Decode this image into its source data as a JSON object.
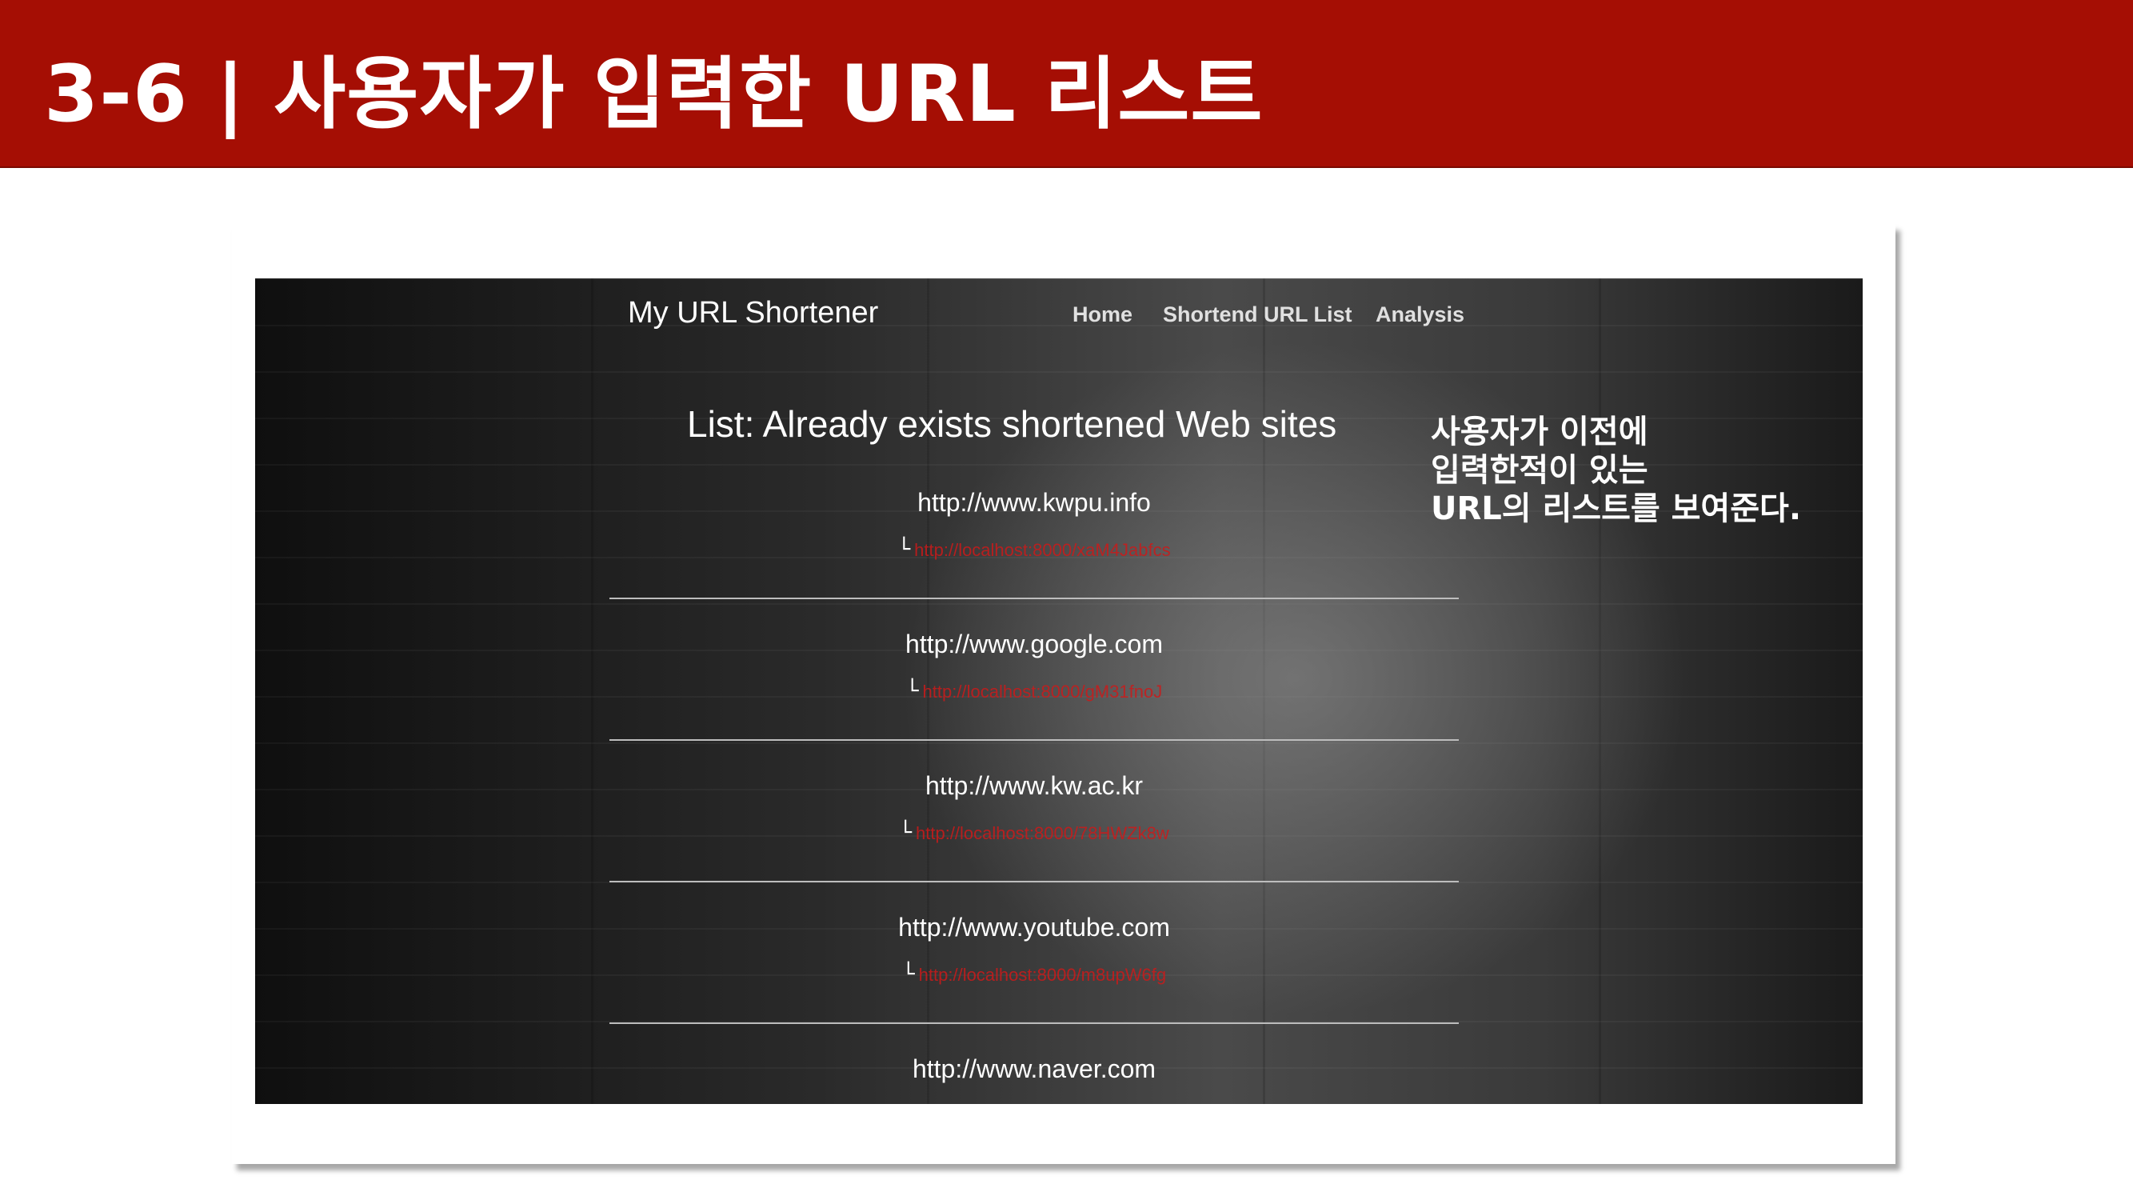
{
  "slide": {
    "title": "3-6 | 사용자가 입력한 URL 리스트"
  },
  "app": {
    "brand": "My URL Shortener",
    "nav": {
      "home": "Home",
      "list": "Shortend URL List",
      "analysis": "Analysis"
    },
    "heading": "List: Already exists shortened Web sites"
  },
  "annotation": {
    "lines": [
      "사용자가 이전에",
      "입력한적이 있는",
      "URL의 리스트를 보여준다."
    ]
  },
  "corner_glyph": "└",
  "entries": [
    {
      "original": "http://www.kwpu.info",
      "short": "http://localhost:8000/xaM4Jabfcs"
    },
    {
      "original": "http://www.google.com",
      "short": "http://localhost:8000/gM31fnoJ"
    },
    {
      "original": "http://www.kw.ac.kr",
      "short": "http://localhost:8000/78HWZk8w"
    },
    {
      "original": "http://www.youtube.com",
      "short": "http://localhost:8000/m8upW6fg"
    },
    {
      "original": "http://www.naver.com",
      "short": ""
    }
  ],
  "colors": {
    "header": "#a50e04",
    "short_link": "#cc1a1a"
  }
}
